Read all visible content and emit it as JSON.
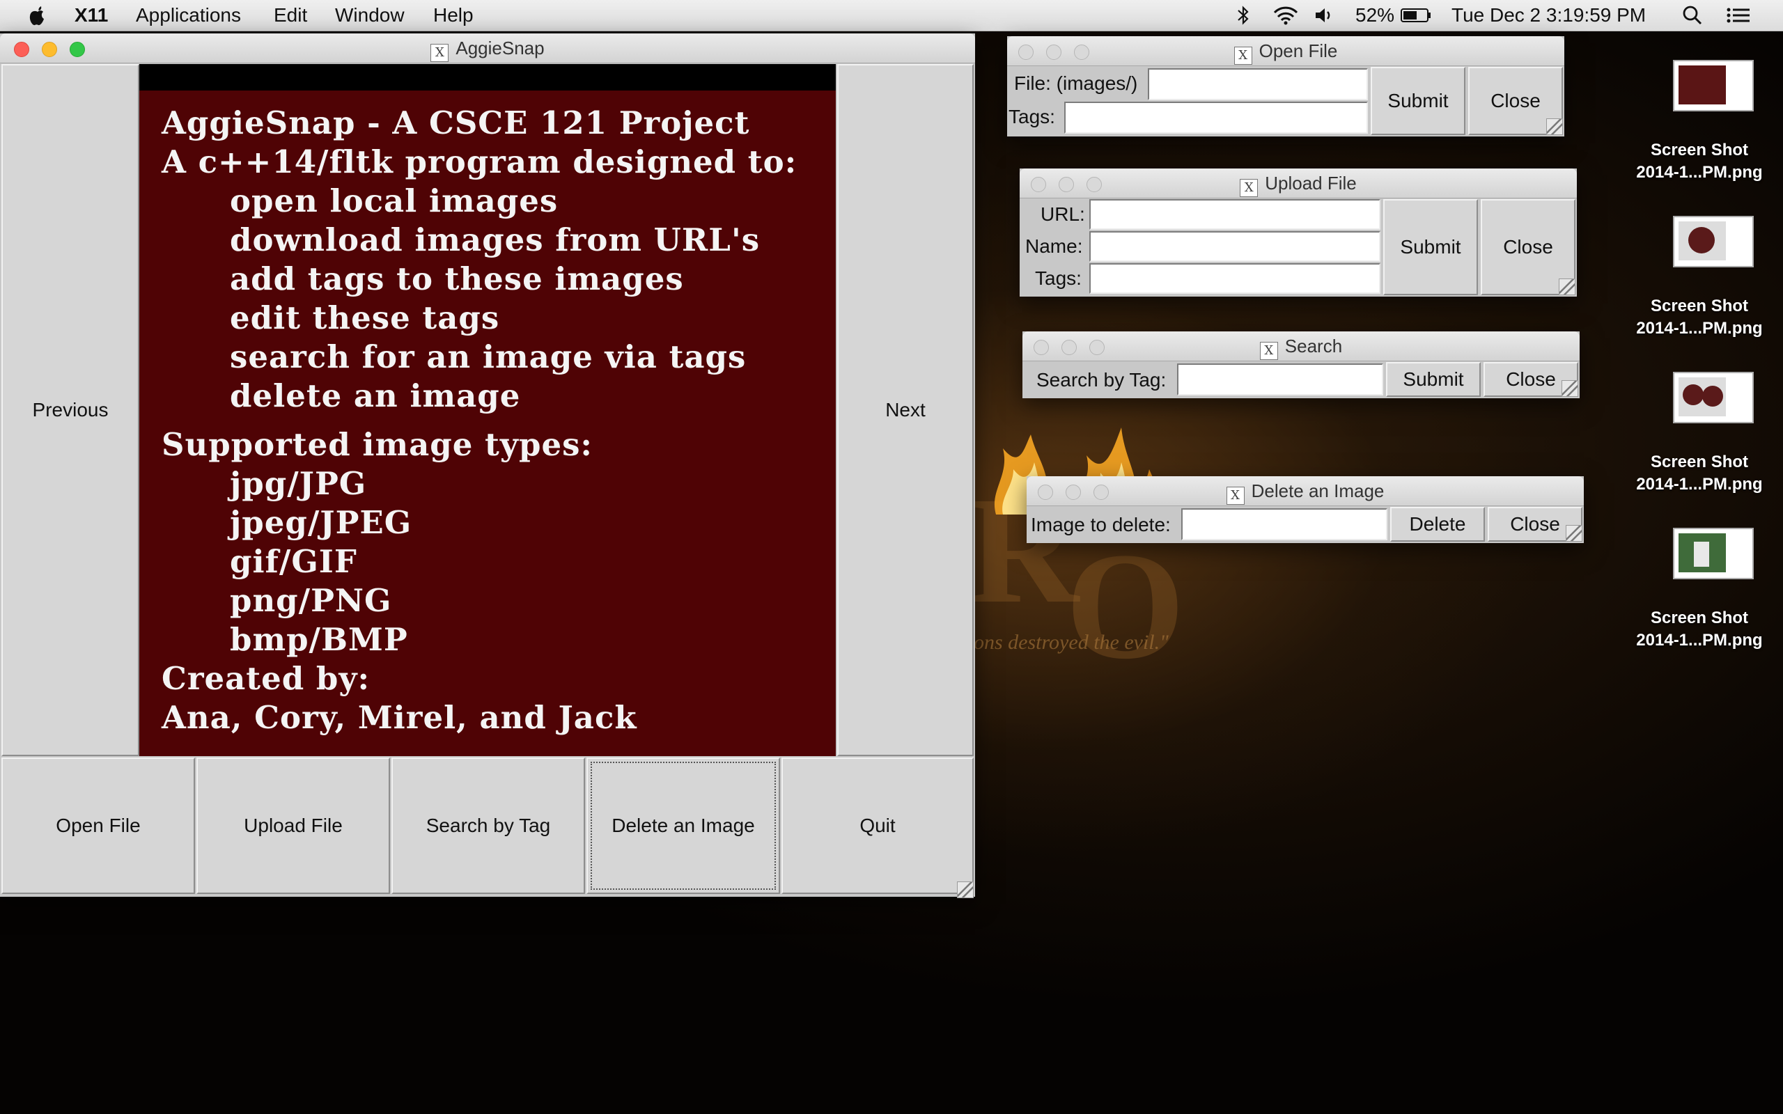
{
  "menubar": {
    "app_name": "X11",
    "menus": [
      "Applications",
      "Edit",
      "Window",
      "Help"
    ],
    "battery_percent": "52%",
    "clock": "Tue Dec 2  3:19:59 PM",
    "icons": [
      "apple-icon",
      "bluetooth-icon",
      "wifi-icon",
      "volume-icon",
      "battery-icon",
      "spotlight-icon",
      "notification-center-icon"
    ]
  },
  "main_window": {
    "title": "AggieSnap",
    "previous_label": "Previous",
    "next_label": "Next",
    "display_lines": [
      "AggieSnap - A CSCE 121 Project",
      "A c++14/fltk program designed to:",
      "open local images",
      "download images from URL's",
      "add tags to these images",
      "edit these tags",
      "search for an image via tags",
      "delete an image",
      "Supported image types:",
      "jpg/JPG",
      "jpeg/JPEG",
      "gif/GIF",
      "png/PNG",
      "bmp/BMP",
      "Created by:",
      "Ana, Cory, Mirel, and Jack"
    ],
    "buttons": [
      "Open File",
      "Upload File",
      "Search by Tag",
      "Delete an Image",
      "Quit"
    ],
    "focused_button": "Delete an Image"
  },
  "open_file": {
    "title": "Open File",
    "file_label": "File: (images/)",
    "file_value": "",
    "tags_label": "Tags:",
    "tags_value": "",
    "submit": "Submit",
    "close": "Close"
  },
  "upload_file": {
    "title": "Upload File",
    "url_label": "URL:",
    "name_label": "Name:",
    "tags_label": "Tags:",
    "url_value": "",
    "name_value": "",
    "tags_value": "",
    "submit": "Submit",
    "close": "Close"
  },
  "search": {
    "title": "Search",
    "label": "Search by Tag:",
    "value": "",
    "submit": "Submit",
    "close": "Close"
  },
  "delete": {
    "title": "Delete an Image",
    "label": "Image to delete:",
    "value": "",
    "delete": "Delete",
    "close": "Close"
  },
  "desktop": {
    "wallpaper_quote": "ons destroyed the evil.\"",
    "files": [
      {
        "line1": "Screen Shot",
        "line2": "2014-1...PM.png"
      },
      {
        "line1": "Screen Shot",
        "line2": "2014-1...PM.png"
      },
      {
        "line1": "Screen Shot",
        "line2": "2014-1...PM.png"
      },
      {
        "line1": "Screen Shot",
        "line2": "2014-1...PM.png"
      }
    ]
  }
}
